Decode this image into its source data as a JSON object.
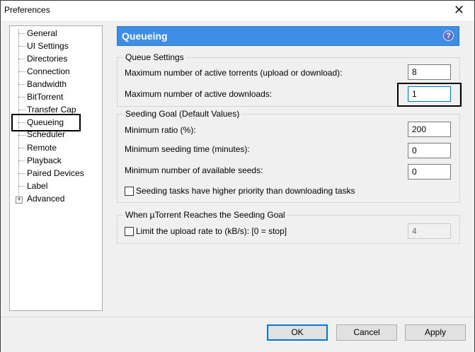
{
  "window": {
    "title": "Preferences",
    "close_glyph": "✕"
  },
  "sidebar": {
    "items": [
      {
        "label": "General"
      },
      {
        "label": "UI Settings"
      },
      {
        "label": "Directories"
      },
      {
        "label": "Connection"
      },
      {
        "label": "Bandwidth"
      },
      {
        "label": "BitTorrent"
      },
      {
        "label": "Transfer Cap"
      },
      {
        "label": "Queueing"
      },
      {
        "label": "Scheduler"
      },
      {
        "label": "Remote"
      },
      {
        "label": "Playback"
      },
      {
        "label": "Paired Devices"
      },
      {
        "label": "Label"
      },
      {
        "label": "Advanced"
      }
    ],
    "selected": "Queueing",
    "expander_glyph": "+"
  },
  "panel": {
    "title": "Queueing",
    "help_glyph": "?"
  },
  "queue_settings": {
    "legend": "Queue Settings",
    "max_active_torrents_label": "Maximum number of active torrents (upload or download):",
    "max_active_torrents_value": "8",
    "max_active_downloads_label": "Maximum number of active downloads:",
    "max_active_downloads_value": "1"
  },
  "seeding_goal": {
    "legend": "Seeding Goal (Default Values)",
    "min_ratio_label": "Minimum ratio (%):",
    "min_ratio_value": "200",
    "min_seeding_time_label": "Minimum seeding time (minutes):",
    "min_seeding_time_value": "0",
    "min_seeds_label": "Minimum number of available seeds:",
    "min_seeds_value": "0",
    "priority_label": "Seeding tasks have higher priority than downloading tasks",
    "priority_checked": false
  },
  "reach_goal": {
    "legend": "When µTorrent Reaches the Seeding Goal",
    "limit_label": "Limit the upload rate to (kB/s): [0 = stop]",
    "limit_checked": false,
    "limit_value": "4"
  },
  "footer": {
    "ok_label": "OK",
    "cancel_label": "Cancel",
    "apply_label": "Apply"
  }
}
